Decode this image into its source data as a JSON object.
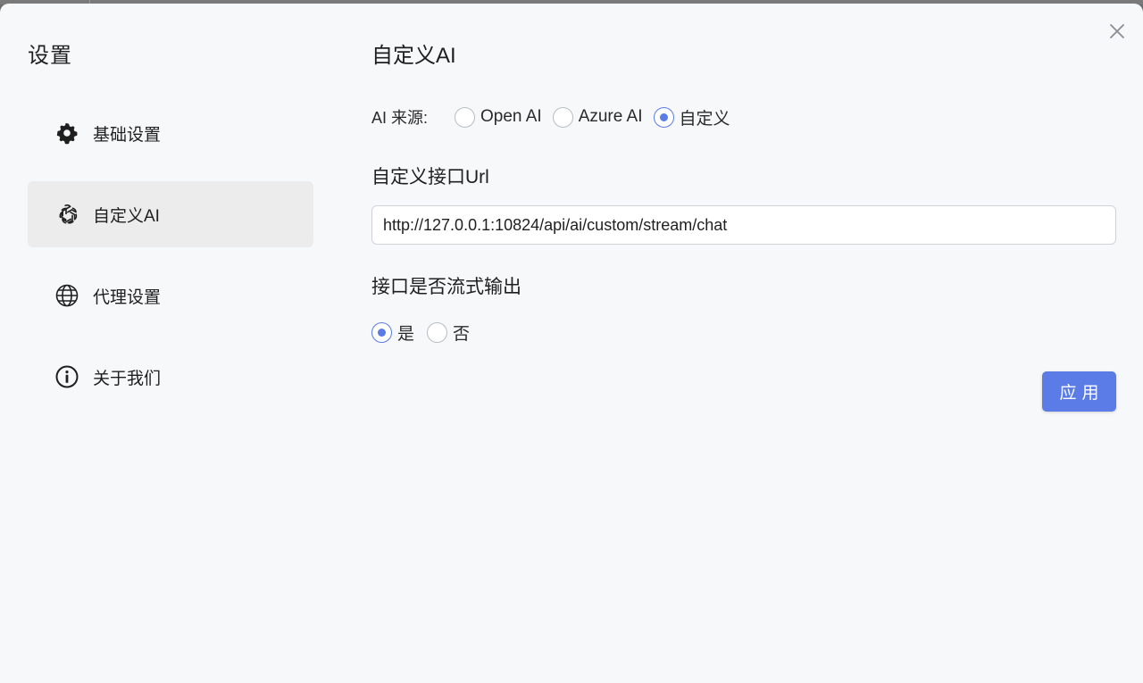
{
  "sidebar": {
    "title": "设置",
    "items": [
      {
        "label": "基础设置",
        "icon": "gear-icon",
        "active": false
      },
      {
        "label": "自定义AI",
        "icon": "openai-icon",
        "active": true
      },
      {
        "label": "代理设置",
        "icon": "globe-icon",
        "active": false
      },
      {
        "label": "关于我们",
        "icon": "info-icon",
        "active": false
      }
    ]
  },
  "main": {
    "title": "自定义AI",
    "source": {
      "label": "AI 来源:",
      "options": [
        "Open AI",
        "Azure AI",
        "自定义"
      ],
      "selected": "自定义"
    },
    "url_section": {
      "label": "自定义接口Url",
      "value": "http://127.0.0.1:10824/api/ai/custom/stream/chat"
    },
    "stream_section": {
      "label": "接口是否流式输出",
      "options": [
        "是",
        "否"
      ],
      "selected": "是"
    },
    "apply_label": "应用"
  },
  "colors": {
    "accent": "#5b7be6",
    "background": "#f7f8fa",
    "active_item": "#ececec"
  }
}
